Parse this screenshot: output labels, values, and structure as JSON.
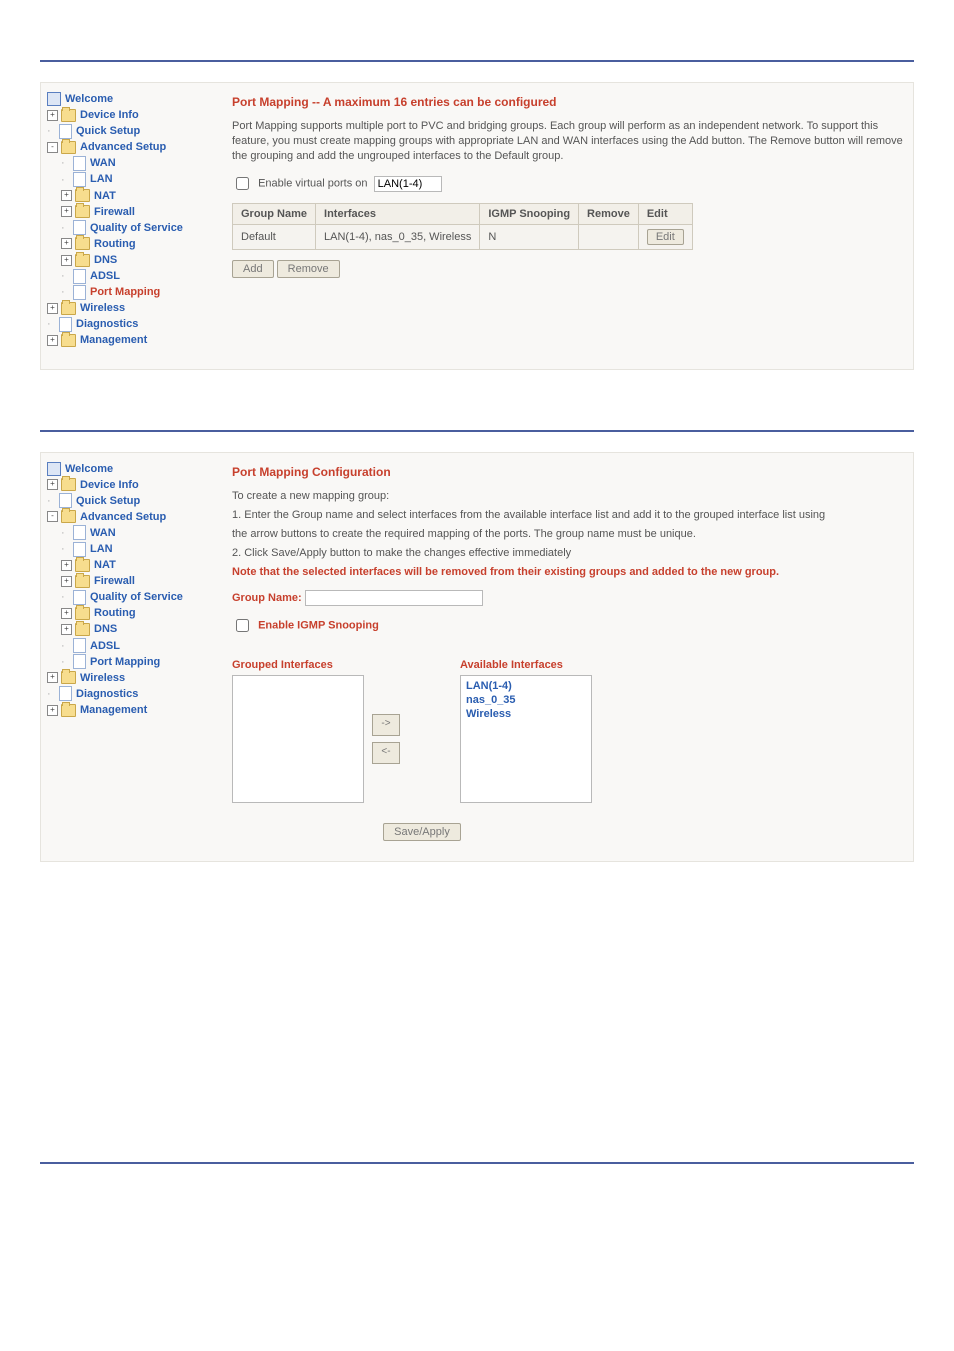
{
  "nav": {
    "root": "Welcome",
    "device_info": "Device Info",
    "quick_setup": "Quick Setup",
    "advanced_setup": "Advanced Setup",
    "wan": "WAN",
    "lan": "LAN",
    "nat": "NAT",
    "firewall": "Firewall",
    "qos": "Quality of Service",
    "routing": "Routing",
    "dns": "DNS",
    "adsl": "ADSL",
    "port_mapping": "Port Mapping",
    "wireless": "Wireless",
    "diagnostics": "Diagnostics",
    "management": "Management"
  },
  "pm": {
    "title": "Port Mapping -- A maximum 16 entries can be configured",
    "desc": "Port Mapping supports multiple port to PVC and bridging groups. Each group will perform as an independent network. To support this feature, you must create mapping groups with appropriate LAN and WAN interfaces using the Add button. The Remove button will remove the grouping and add the ungrouped interfaces to the Default group.",
    "enable_label": "Enable virtual ports on",
    "enable_value": "LAN(1-4)",
    "th_group": "Group Name",
    "th_if": "Interfaces",
    "th_igmp": "IGMP Snooping",
    "th_remove": "Remove",
    "th_edit": "Edit",
    "row": {
      "group": "Default",
      "if": "LAN(1-4), nas_0_35, Wireless",
      "igmp": "N",
      "edit_btn": "Edit"
    },
    "add_btn": "Add",
    "remove_btn": "Remove"
  },
  "pmc": {
    "title": "Port Mapping Configuration",
    "intro": "To create a new mapping group:",
    "step1": "1. Enter the Group name and select interfaces from the available interface list and add it to the grouped interface list using",
    "step1b": "the arrow buttons to create the required mapping of the ports. The group name must be unique.",
    "step2": "2. Click Save/Apply button to make the changes effective immediately",
    "note": "Note that the selected interfaces will be removed from their existing groups and added to the new group.",
    "group_name_label": "Group Name:",
    "igmp_label": "Enable IGMP Snooping",
    "grouped_label": "Grouped Interfaces",
    "avail_label": "Available Interfaces",
    "avail_items": [
      "LAN(1-4)",
      "nas_0_35",
      "Wireless"
    ],
    "arrow_right": "->",
    "arrow_left": "<-",
    "save_btn": "Save/Apply"
  }
}
